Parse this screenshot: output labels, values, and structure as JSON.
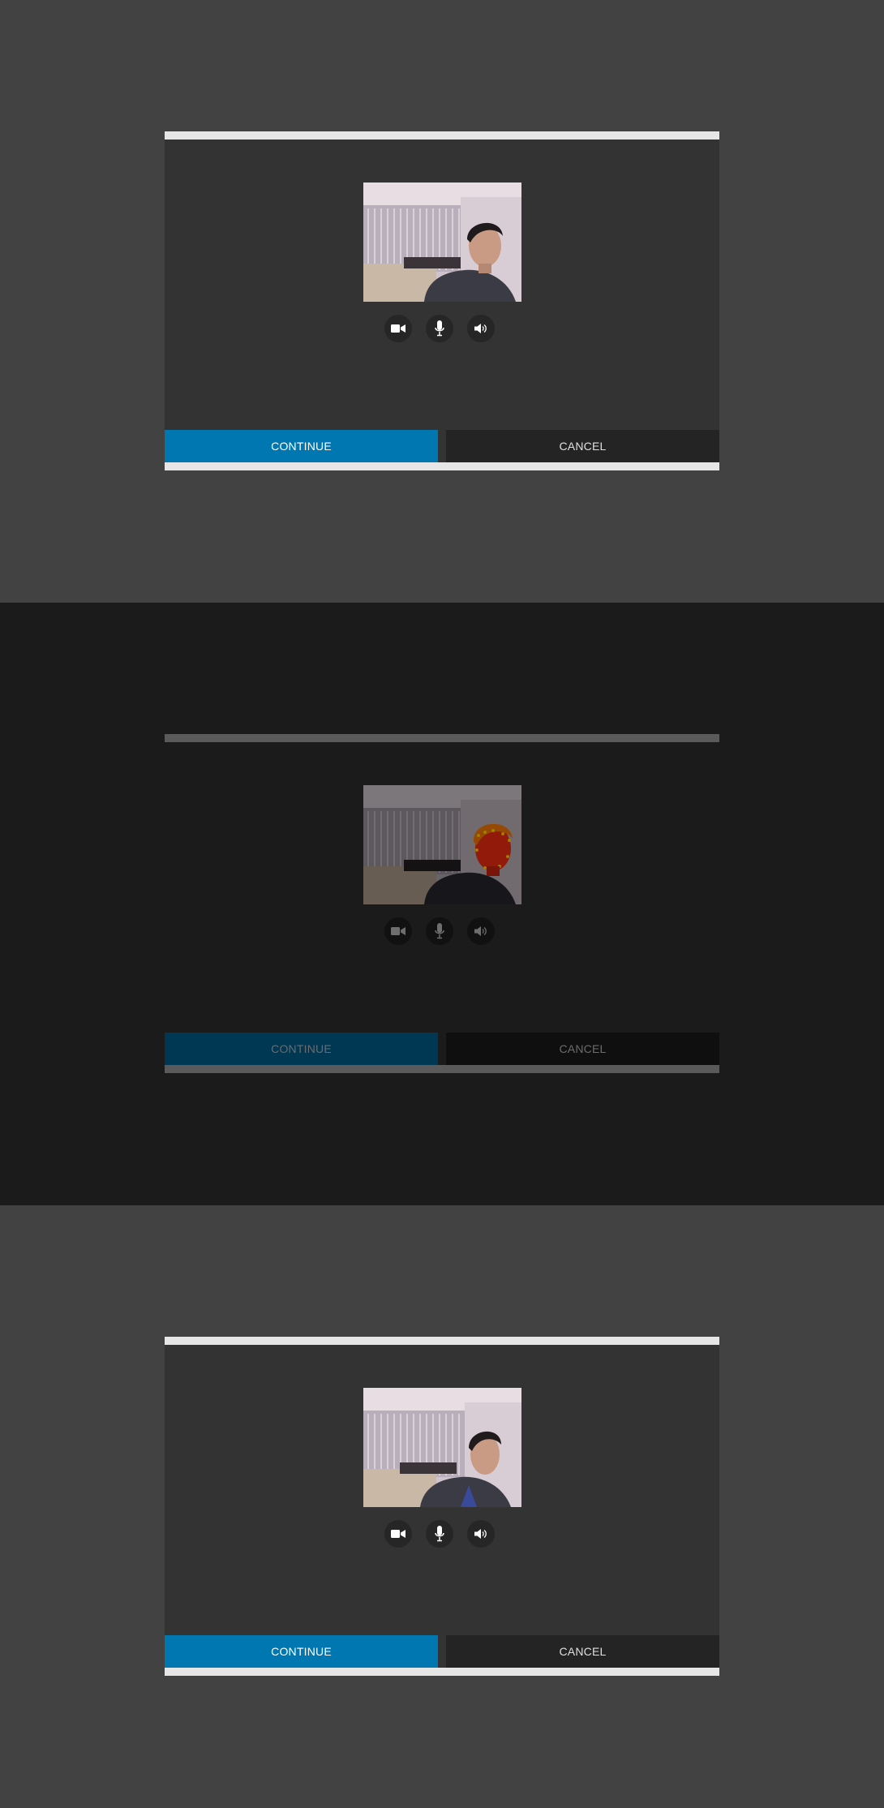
{
  "screens": [
    {
      "state": "normal",
      "controls": {
        "camera_icon": "video-camera-icon",
        "mic_icon": "microphone-icon",
        "speaker_icon": "speaker-icon"
      },
      "buttons": {
        "continue_label": "CONTINUE",
        "cancel_label": "CANCEL"
      }
    },
    {
      "state": "dimmed",
      "controls": {
        "camera_icon": "video-camera-icon",
        "mic_icon": "microphone-icon",
        "speaker_icon": "speaker-icon"
      },
      "buttons": {
        "continue_label": "CONTINUE",
        "cancel_label": "CANCEL"
      }
    },
    {
      "state": "normal",
      "controls": {
        "camera_icon": "video-camera-icon",
        "mic_icon": "microphone-icon",
        "speaker_icon": "speaker-icon"
      },
      "buttons": {
        "continue_label": "CONTINUE",
        "cancel_label": "CANCEL"
      }
    }
  ],
  "colors": {
    "background": "#424242",
    "overlay_background": "#1b1b1b",
    "dialog": "#333333",
    "accent": "#0077b0",
    "cancel": "#242424"
  }
}
